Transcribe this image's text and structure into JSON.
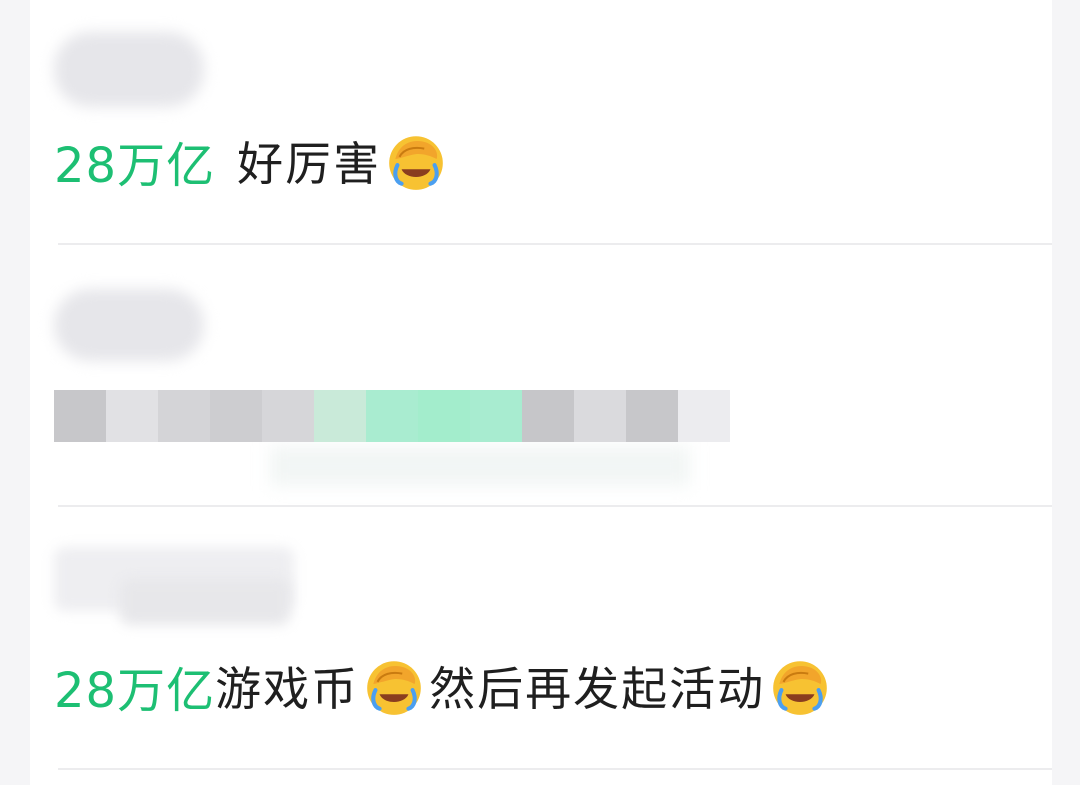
{
  "comments": [
    {
      "highlight": "28万亿",
      "text": "好厉害",
      "emoji_1": "face-palm-tears-emoji"
    },
    {
      "content_state": "pixelated"
    },
    {
      "highlight": "28万亿",
      "text_1": "游戏币",
      "text_2": "然后再发起活动",
      "emoji_1": "face-palm-tears-emoji",
      "emoji_2": "face-palm-tears-emoji"
    }
  ],
  "colors": {
    "highlight": "#1dbf73",
    "text": "#1f1f1f",
    "emoji_face": "#f7c232",
    "emoji_hand": "#f2a52b",
    "emoji_tear": "#4b9ff0"
  }
}
